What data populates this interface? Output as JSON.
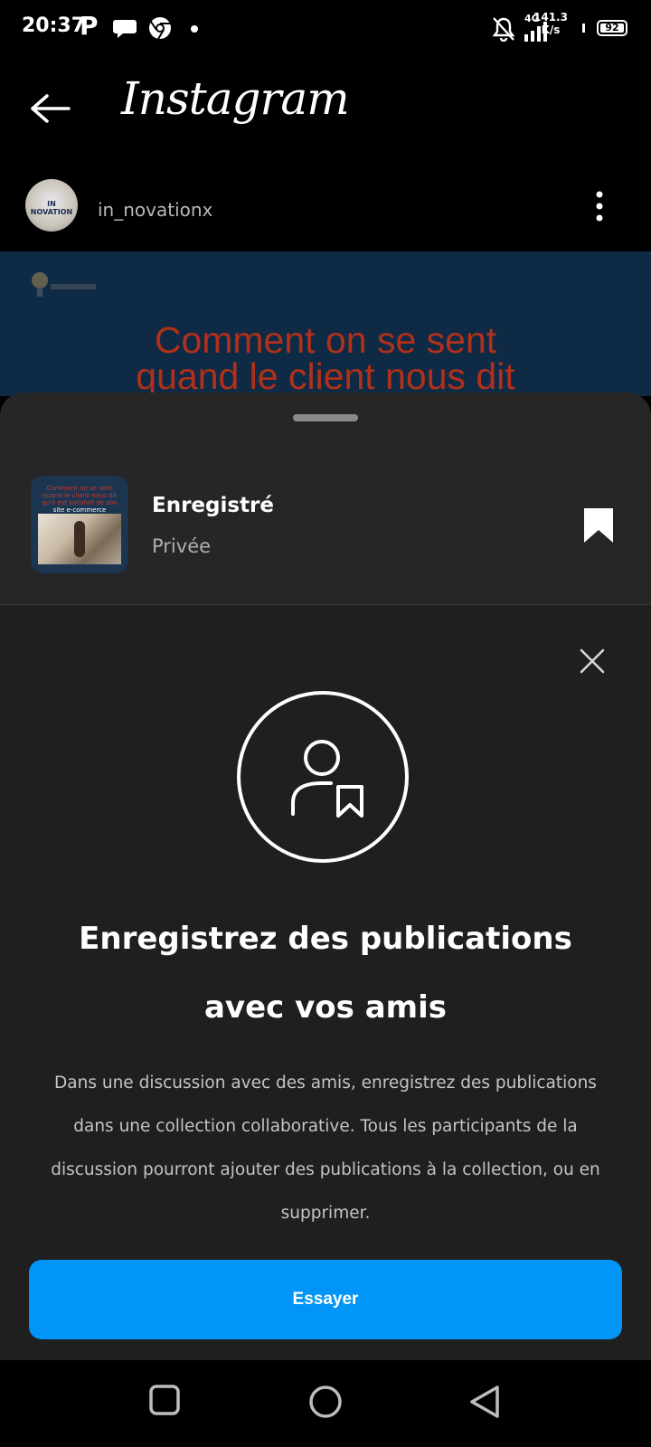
{
  "status_bar": {
    "time": "20:37",
    "p_icon": "P",
    "network_type": "4G",
    "net_speed_value": "141.3",
    "net_speed_unit": "K/s",
    "battery": "92"
  },
  "header": {
    "title": "Instagram"
  },
  "post": {
    "username": "in_novationx",
    "avatar_text": "IN NOVATION",
    "media_line1": "Comment on se sent",
    "media_line2": "quand le client  nous dit"
  },
  "collection": {
    "title": "Enregistré",
    "privacy": "Privée",
    "thumb_line1": "Comment on se sent",
    "thumb_line2": "quand le client  nous dit",
    "thumb_line3": "qu'il est satisfait de son",
    "thumb_line4": "site e-commerce"
  },
  "promo": {
    "headline": "Enregistrez des publications avec vos amis",
    "body": "Dans une discussion avec des amis, enregistrez des publications dans une collection collaborative. Tous les participants de la discussion pourront ajouter des publications à la collection, ou en supprimer.",
    "button_label": "Essayer"
  },
  "colors": {
    "background": "#000000",
    "sheet": "#1f1f1f",
    "accent": "#0095f6",
    "post_text": "#b1301a"
  }
}
